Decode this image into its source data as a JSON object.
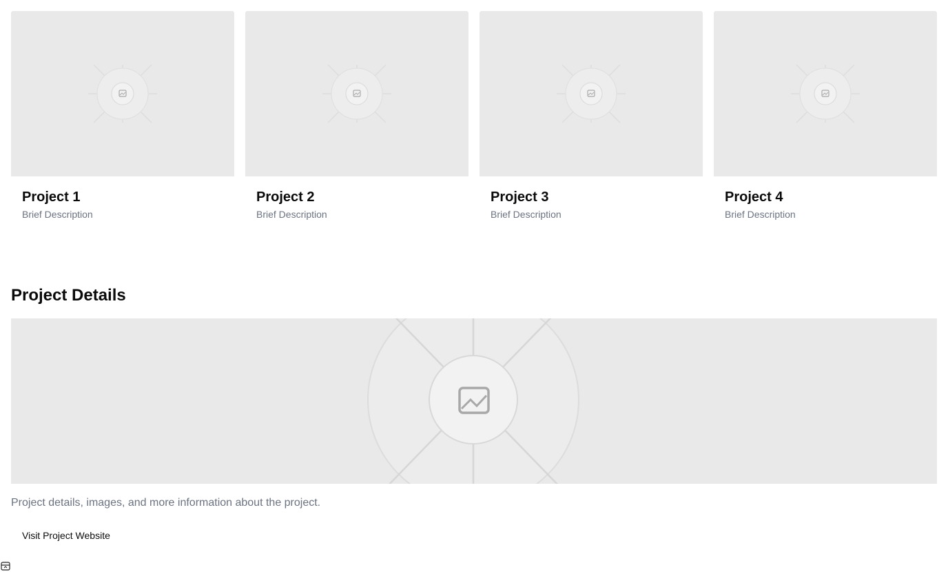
{
  "projects": [
    {
      "title": "Project 1",
      "description": "Brief Description",
      "image_icon": "image-placeholder-icon"
    },
    {
      "title": "Project 2",
      "description": "Brief Description",
      "image_icon": "image-placeholder-icon"
    },
    {
      "title": "Project 3",
      "description": "Brief Description",
      "image_icon": "image-placeholder-icon"
    },
    {
      "title": "Project 4",
      "description": "Brief Description",
      "image_icon": "image-placeholder-icon"
    }
  ],
  "details": {
    "heading": "Project Details",
    "image_icon": "image-placeholder-icon",
    "text": "Project details, images, and more information about the project.",
    "link_label": "Visit Project Website"
  },
  "corner_icon": "panel-icon",
  "colors": {
    "placeholder_bg": "#e9e9e9",
    "muted_text": "#6b7280",
    "heading_text": "#0a0a0a"
  }
}
